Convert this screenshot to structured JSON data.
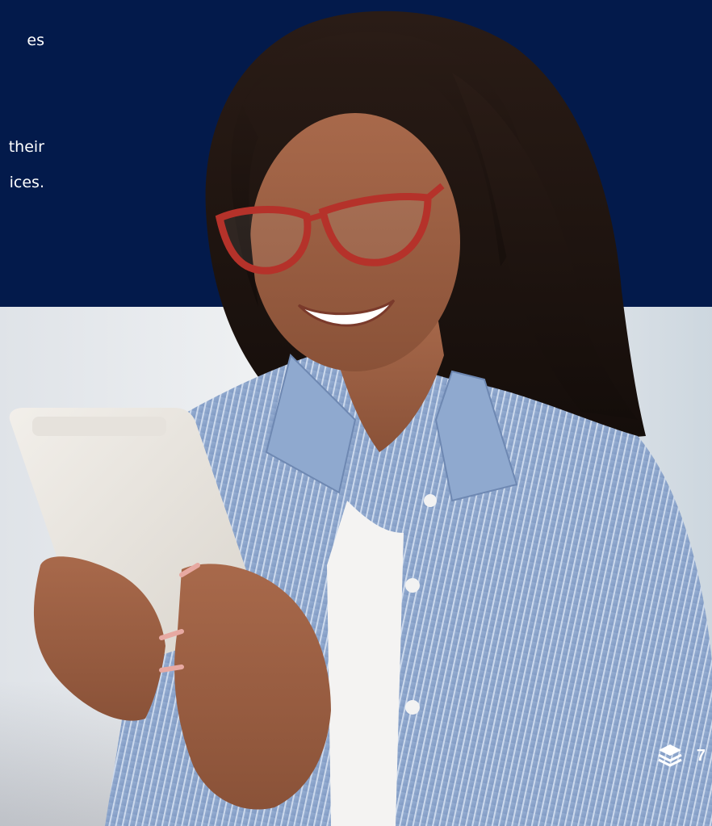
{
  "text_column": {
    "lines": [
      "es",
      "",
      "",
      "their",
      "ices."
    ]
  },
  "footer": {
    "icon": "layers-stack-icon",
    "page_number": "7"
  },
  "colors": {
    "navy": "#031a4b",
    "white": "#ffffff"
  }
}
